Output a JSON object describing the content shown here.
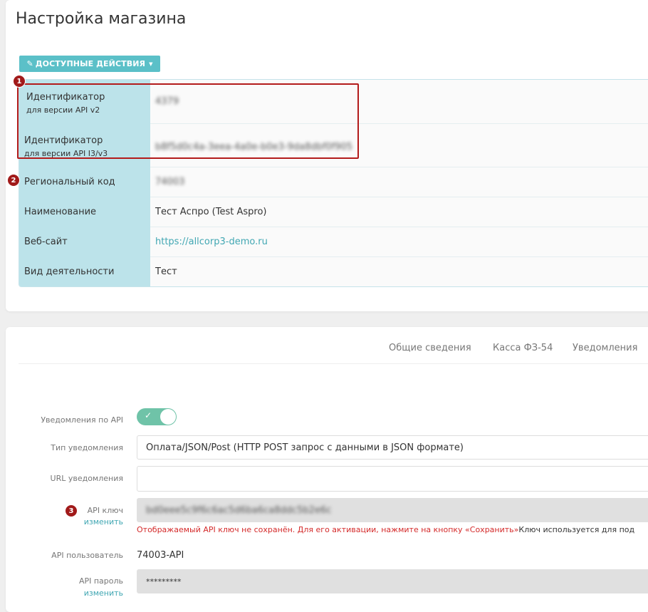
{
  "page": {
    "title": "Настройка магазина"
  },
  "actions": {
    "label": "ДОСТУПНЫЕ ДЕЙСТВИЯ",
    "wand_icon": "magic-wand-icon",
    "caret_icon": "caret-down-icon"
  },
  "info": {
    "rows": [
      {
        "label": "Идентификатор",
        "sub": "для версии API v2",
        "value": "4379"
      },
      {
        "label": "Идентификатор",
        "sub": "для версии API I3/v3",
        "value": "b8f5d0c4a-3eea-4a0e-b0e3-9da8dbf0f905"
      },
      {
        "label": "Региональный код",
        "value": "74003"
      },
      {
        "label": "Наименование",
        "value": "Тест Аспро (Test Aspro)"
      },
      {
        "label": "Веб-сайт",
        "value": "https://allcorp3-demo.ru"
      },
      {
        "label": "Вид деятельности",
        "value": "Тест"
      }
    ]
  },
  "badges": [
    "1",
    "2",
    "3"
  ],
  "tabs": [
    "Общие сведения",
    "Касса ФЗ-54",
    "Уведомления"
  ],
  "form": {
    "notify_label": "Уведомления по API",
    "notify_on": true,
    "type_label": "Тип уведомления",
    "type_value": "Оплата/JSON/Post (HTTP POST запрос с данными в JSON формате)",
    "url_label": "URL уведомления",
    "url_value": "",
    "key_label": "API ключ",
    "key_change": "изменить",
    "key_value": "bd0eee5c9f6c6ac5d6ba6ca8ddc5b2e6c",
    "note_red": "Отображаемый API ключ не сохранён. Для его активации, нажмите на кнопку «Сохранить»",
    "note_black": "Ключ используется для под",
    "user_label": "API пользователь",
    "user_value": "74003-API",
    "pass_label": "API пароль",
    "pass_change": "изменить",
    "pass_value": "*********"
  },
  "colors": {
    "accent": "#5bc0c8",
    "label_bg": "#bce3ea",
    "highlight": "#b31b1b",
    "toggle": "#6fc3a8",
    "error": "#d42a2a"
  }
}
